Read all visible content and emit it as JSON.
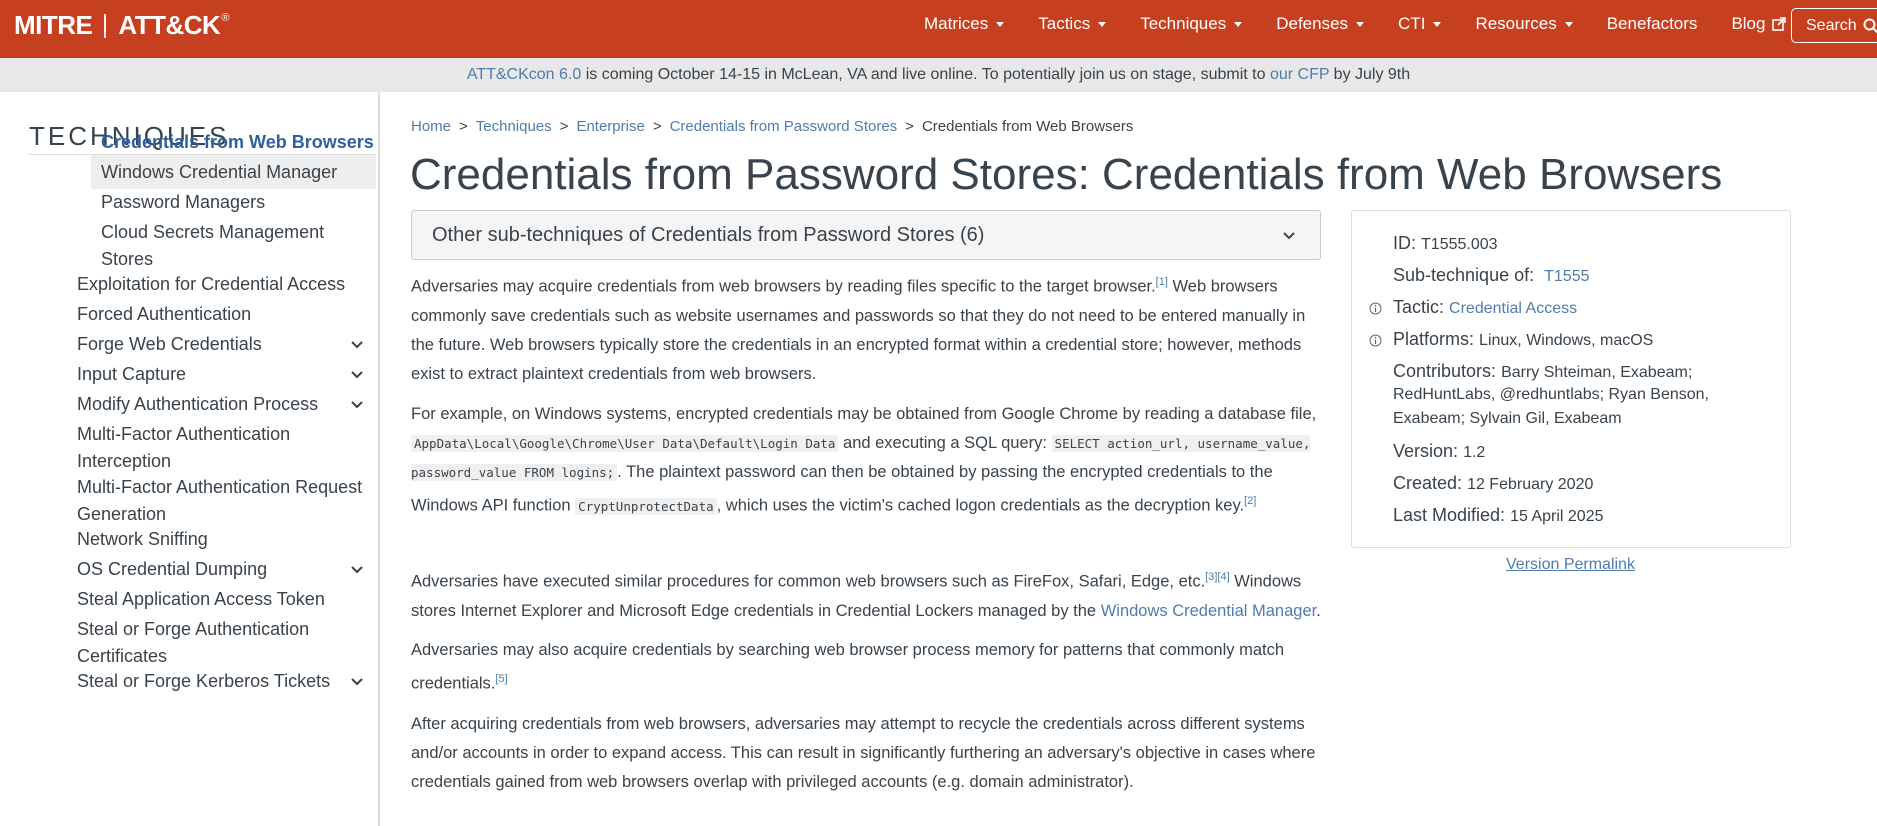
{
  "header": {
    "logo_left": "MITRE",
    "logo_right": "ATT&CK",
    "logo_mark": "®",
    "nav": [
      {
        "label": "Matrices",
        "dropdown": true
      },
      {
        "label": "Tactics",
        "dropdown": true
      },
      {
        "label": "Techniques",
        "dropdown": true
      },
      {
        "label": "Defenses",
        "dropdown": true
      },
      {
        "label": "CTI",
        "dropdown": true
      },
      {
        "label": "Resources",
        "dropdown": true
      },
      {
        "label": "Benefactors",
        "dropdown": false
      },
      {
        "label": "Blog",
        "dropdown": false,
        "icon": "external-link-icon"
      }
    ],
    "search_label": "Search",
    "colors": {
      "nav_bg": "#c63f1f",
      "link": "#4f7cac"
    }
  },
  "banner": {
    "link1": "ATT&CKcon 6.0",
    "text1": " is coming October 14-15 in McLean, VA and live online. To potentially join us on stage, submit to ",
    "link2": "our CFP",
    "text2": " by July 9th"
  },
  "sidebar": {
    "title": "TECHNIQUES",
    "items": [
      {
        "label": "Credentials from Web Browsers",
        "active": true,
        "expandable": false
      },
      {
        "label": "Windows Credential Manager",
        "expandable": false
      },
      {
        "label": "Password Managers",
        "expandable": false
      },
      {
        "label": "Cloud Secrets Management",
        "label2": "Stores",
        "expandable": false
      },
      {
        "label": "Exploitation for Credential Access",
        "expandable": false
      },
      {
        "label": "Forced Authentication",
        "expandable": false
      },
      {
        "label": "Forge Web Credentials",
        "expandable": true
      },
      {
        "label": "Input Capture",
        "expandable": true
      },
      {
        "label": "Modify Authentication Process",
        "expandable": true
      },
      {
        "label": "Multi-Factor Authentication",
        "label2": "Interception",
        "expandable": false
      },
      {
        "label": "Multi-Factor Authentication Request",
        "label2": "Generation",
        "expandable": false
      },
      {
        "label": "Network Sniffing",
        "expandable": false
      },
      {
        "label": "OS Credential Dumping",
        "expandable": true
      },
      {
        "label": "Steal Application Access Token",
        "expandable": false
      },
      {
        "label": "Steal or Forge Authentication",
        "label2": "Certificates",
        "expandable": false
      },
      {
        "label": "Steal or Forge Kerberos Tickets",
        "expandable": true
      }
    ]
  },
  "breadcrumb": [
    "Home",
    "Techniques",
    "Enterprise",
    "Credentials from Password Stores",
    "Credentials from Web Browsers"
  ],
  "breadcrumb_sep": ">",
  "title": "Credentials from Password Stores: Credentials from Web Browsers",
  "subtechniques_label": "Other sub-techniques of Credentials from Password Stores (6)",
  "body": {
    "p1": {
      "a": "Adversaries may acquire credentials from web browsers by reading files specific to the target browser.",
      "ref": "[1]",
      "b": " Web browsers commonly save credentials such as website usernames and passwords so that they do not need to be entered manually in the future. Web browsers typically store the credentials in an encrypted format within a credential store; however, methods exist to extract plaintext credentials from web browsers."
    },
    "p2": {
      "a": "For example, on Windows systems, encrypted credentials may be obtained from Google Chrome by reading a database file, ",
      "code1": "AppData\\Local\\Google\\Chrome\\User Data\\Default\\Login Data",
      "b": " and executing a SQL query: ",
      "code2": "SELECT action_url, username_value, password_value FROM logins;",
      "c": ". The plaintext password can then be obtained by passing the encrypted credentials to the Windows API function ",
      "code3": "CryptUnprotectData",
      "d": ", which uses the victim's cached logon credentials as the decryption key.",
      "ref": "[2]"
    },
    "p3": {
      "a": "Adversaries have executed similar procedures for common web browsers such as FireFox, Safari, Edge, etc.",
      "ref": "[3][4]",
      "b": " Windows stores Internet Explorer and Microsoft Edge credentials in Credential Lockers managed by the ",
      "link": "Windows Credential Manager",
      "c": "."
    },
    "p4": {
      "a": "Adversaries may also acquire credentials by searching web browser process memory for patterns that commonly match credentials.",
      "ref": "[5]"
    },
    "p5": "After acquiring credentials from web browsers, adversaries may attempt to recycle the credentials across different systems and/or accounts in order to expand access. This can result in significantly furthering an adversary's objective in cases where credentials gained from web browsers overlap with privileged accounts (e.g. domain administrator)."
  },
  "card": {
    "id_label": "ID:",
    "id": "T1555.003",
    "sub_label": "Sub-technique of:",
    "sub": "T1555",
    "tactic_label": "Tactic:",
    "tactic": "Credential Access",
    "platforms_label": "Platforms:",
    "platforms": "Linux, Windows, macOS",
    "contributors_label": "Contributors:",
    "contributors_1": "Barry Shteiman, Exabeam;",
    "contributors_2": "RedHuntLabs, @redhuntlabs; Ryan Benson,",
    "contributors_3": "Exabeam; Sylvain Gil, Exabeam",
    "version_label": "Version:",
    "version": "1.2",
    "created_label": "Created:",
    "created": "12 February 2020",
    "modified_label": "Last Modified:",
    "modified": "15 April 2025"
  },
  "permalink": "Version Permalink"
}
